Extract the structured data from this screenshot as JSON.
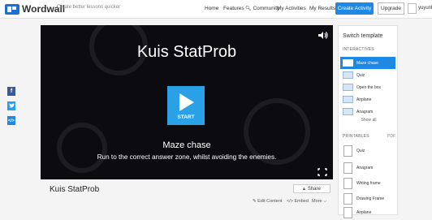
{
  "header": {
    "logo_text": "Wordwall",
    "tagline": "Create better lessons quicker",
    "nav": {
      "home": "Home",
      "features": "Features",
      "community": "Community",
      "my_activities": "My Activities",
      "my_results": "My Results"
    },
    "create_activity": "Create Activity",
    "upgrade": "Upgrade",
    "username": "yuyunkh"
  },
  "social": {
    "facebook": "f",
    "twitter": "t",
    "embed": "</>"
  },
  "player": {
    "title": "Kuis StatProb",
    "start_label": "START",
    "template_name": "Maze chase",
    "template_description": "Run to the correct answer zone, whilst avoiding the enemies."
  },
  "activity": {
    "title": "Kuis StatProb",
    "share": "Share",
    "edit_content": "Edit Content",
    "embed": "Embed",
    "more": "More"
  },
  "switch_panel": {
    "title": "Switch template",
    "interactives_header": "INTERACTIVES",
    "interactives": [
      "Maze chase",
      "Quiz",
      "Open the box",
      "Airplane",
      "Anagram"
    ],
    "show_all": "Show all",
    "printables_header": "PRINTABLES",
    "pdf_label": "PDF",
    "printables": [
      "Quiz",
      "Anagram",
      "Writing frame",
      "Drawing Frame",
      "Airplane"
    ]
  },
  "colors": {
    "accent": "#1e88e5",
    "play_button": "#2aa0e6",
    "facebook": "#3b5998",
    "twitter": "#1da1f2",
    "embed": "#1e88e5"
  },
  "icons": {
    "sound": "speaker-icon",
    "fullscreen": "fullscreen-icon",
    "play": "play-icon",
    "lock": "lock-icon"
  }
}
